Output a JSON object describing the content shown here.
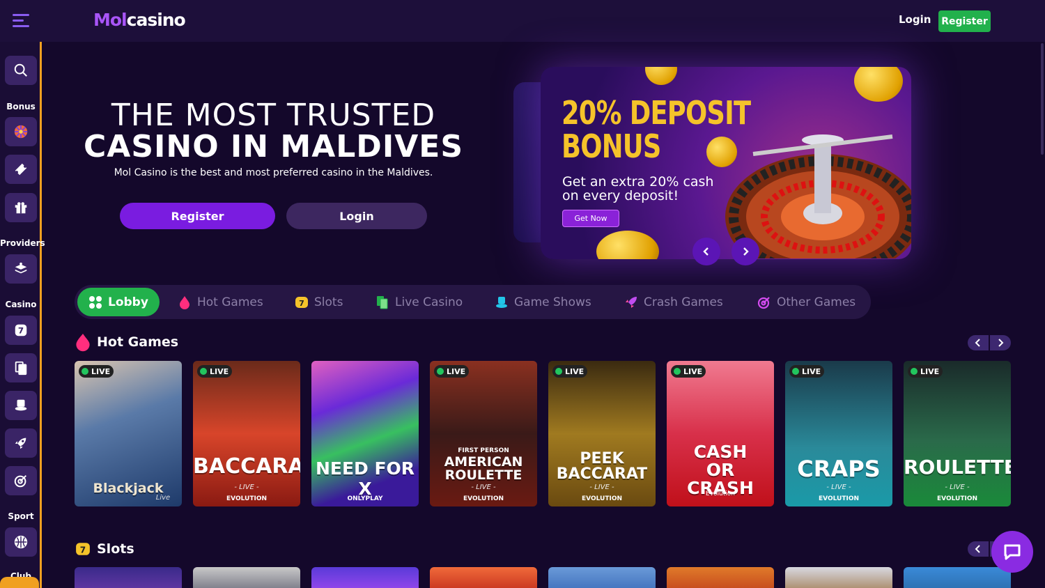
{
  "header": {
    "logo_part1": "Mol",
    "logo_part2": "casino",
    "login_label": "Login",
    "register_label": "Register"
  },
  "sidebar": {
    "sections": {
      "bonus": "Bonus",
      "providers": "Providers",
      "casino": "Casino",
      "sport": "Sport",
      "club": "Club"
    }
  },
  "hero": {
    "title_line1": "THE MOST TRUSTED",
    "title_line2": "CASINO IN MALDIVES",
    "subtitle": "Mol Casino is the best and most preferred casino in the Maldives.",
    "register_label": "Register",
    "login_label": "Login"
  },
  "banner": {
    "title_line1": "20% DEPOSIT",
    "title_line2": "BONUS",
    "text": "Get an extra 20% cash on every deposit!",
    "cta_label": "Get Now"
  },
  "tabs": [
    {
      "label": "Lobby",
      "icon": "grid-icon"
    },
    {
      "label": "Hot Games",
      "icon": "flame-icon"
    },
    {
      "label": "Slots",
      "icon": "slot-seven-icon"
    },
    {
      "label": "Live Casino",
      "icon": "cards-icon"
    },
    {
      "label": "Game Shows",
      "icon": "hat-icon"
    },
    {
      "label": "Crash Games",
      "icon": "rocket-icon"
    },
    {
      "label": "Other Games",
      "icon": "target-icon"
    }
  ],
  "hot_games": {
    "title": "Hot Games",
    "games": [
      {
        "name": "Blackjack",
        "sub": "Live",
        "provider": "",
        "live": "LIVE"
      },
      {
        "name": "BACCARAT",
        "sub": "- LIVE -",
        "provider": "EVOLUTION",
        "live": "LIVE"
      },
      {
        "name": "NEED FOR X",
        "sub": "",
        "provider": "ONLYPLAY",
        "live": ""
      },
      {
        "name": "AMERICAN ROULETTE",
        "sub": "- LIVE -",
        "provider": "EVOLUTION",
        "live": "LIVE",
        "pre": "FIRST PERSON"
      },
      {
        "name": "PEEK BACCARAT",
        "sub": "- LIVE -",
        "provider": "EVOLUTION",
        "live": "LIVE"
      },
      {
        "name": "CASH OR CRASH",
        "sub": "",
        "provider": "Evolution",
        "live": "LIVE"
      },
      {
        "name": "CRAPS",
        "sub": "- LIVE -",
        "provider": "EVOLUTION",
        "live": "LIVE"
      },
      {
        "name": "ROULETTE",
        "sub": "- LIVE -",
        "provider": "EVOLUTION",
        "live": "LIVE"
      }
    ]
  },
  "slots": {
    "title": "Slots"
  },
  "colors": {
    "accent_green": "#22b14c",
    "accent_purple": "#7a1ce0",
    "background": "#14082b",
    "banner_gold": "#f5c32a"
  }
}
